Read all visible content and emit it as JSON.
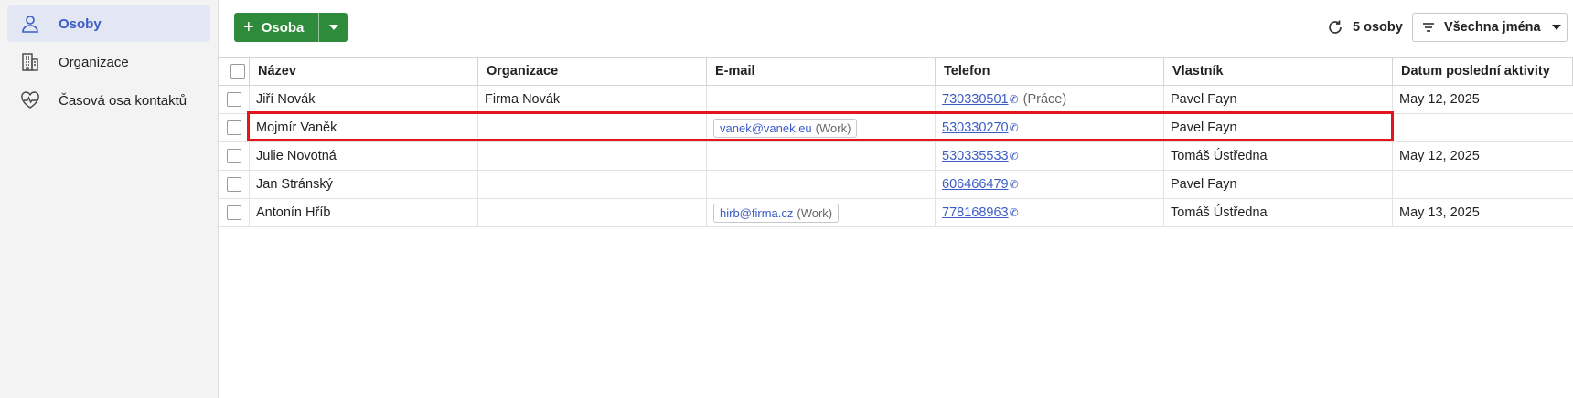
{
  "sidebar": {
    "items": [
      {
        "label": "Osoby",
        "icon": "person-icon",
        "active": true
      },
      {
        "label": "Organizace",
        "icon": "building-icon",
        "active": false
      },
      {
        "label": "Časová osa kontaktů",
        "icon": "heart-pulse-icon",
        "active": false
      }
    ]
  },
  "toolbar": {
    "add_label": "Osoba",
    "count_label": "5 osoby",
    "filter_label": "Všechna jména"
  },
  "table": {
    "headers": [
      "Název",
      "Organizace",
      "E-mail",
      "Telefon",
      "Vlastník",
      "Datum poslední aktivity"
    ],
    "rows": [
      {
        "name": "Jiří Novák",
        "organization": "Firma Novák",
        "email": "",
        "email_type": "",
        "phone": "730330501",
        "phone_type": "(Práce)",
        "owner": "Pavel Fayn",
        "last_activity": "May 12, 2025"
      },
      {
        "name": "Mojmír Vaněk",
        "organization": "",
        "email": "vanek@vanek.eu",
        "email_type": "(Work)",
        "phone": "530330270",
        "phone_type": "",
        "owner": "Pavel Fayn",
        "last_activity": ""
      },
      {
        "name": "Julie Novotná",
        "organization": "",
        "email": "",
        "email_type": "",
        "phone": "530335533",
        "phone_type": "",
        "owner": "Tomáš Ústředna",
        "last_activity": "May 12, 2025"
      },
      {
        "name": "Jan Stránský",
        "organization": "",
        "email": "",
        "email_type": "",
        "phone": "606466479",
        "phone_type": "",
        "owner": "Pavel Fayn",
        "last_activity": ""
      },
      {
        "name": "Antonín Hříb",
        "organization": "",
        "email": "hirb@firma.cz",
        "email_type": "(Work)",
        "phone": "778168963",
        "phone_type": "",
        "owner": "Tomáš Ústředna",
        "last_activity": "May 13, 2025"
      }
    ]
  },
  "colors": {
    "accent": "#3b5cc6",
    "primary_button": "#2e8b3b",
    "highlight_box": "#e3161b",
    "sidebar_active_bg": "#e2e7f3"
  }
}
